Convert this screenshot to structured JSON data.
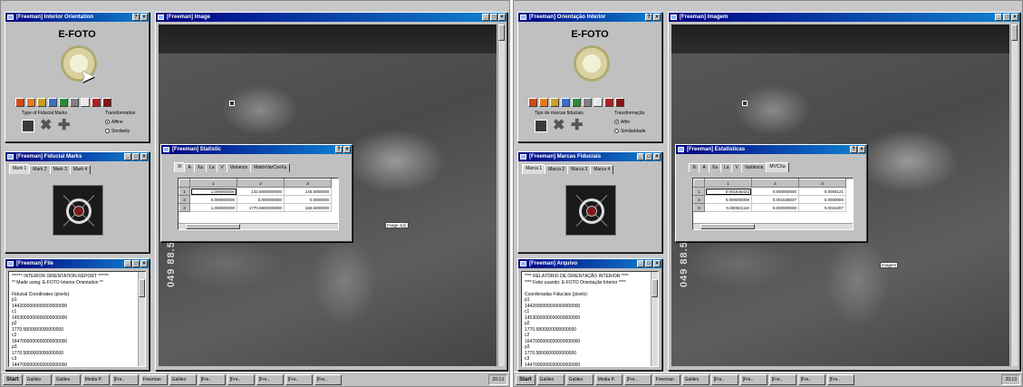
{
  "left": {
    "orientation_window": {
      "title": "[Freeman] Interior Orientation",
      "logo": "E-FOTO",
      "fiducial_group_label": "Type of Fiducial Marks",
      "transformation_group_label": "Transformation",
      "radio_affine": "Affine",
      "radio_similarity": "Similarity"
    },
    "fiducial_window": {
      "title": "[Freeman] Fiducial Marks",
      "tabs": [
        "Mark 1",
        "Mark 2",
        "Mark 3",
        "Mark 4"
      ]
    },
    "file_window": {
      "title": "[Freeman] File",
      "lines": [
        "****** INTERIOR ORIENTATION REPORT ******",
        "** Made using: E-FOTO Interior Orientation **",
        "",
        "Fiducial Coordinates (pixels):",
        "p1",
        "1442000000000000000000",
        "c1",
        "1453000000000000000000",
        "p2",
        "1770.5800000000000000",
        "c2",
        "1647000000000000000000",
        "p3",
        "1770.5800000000000000",
        "c3",
        "1447000000000000000000"
      ]
    },
    "image_window": {
      "title": "[Freeman] Image",
      "film_label": "049 88.57",
      "tag": "Image 1(s)"
    },
    "stats_window": {
      "title": "[Freeman] Statistic",
      "tabs": [
        "Xi",
        "A",
        "Xa",
        "La",
        "V",
        "Variance",
        "MatrixVarCovXa"
      ],
      "col_headers": [
        "",
        "1",
        "2",
        "3"
      ],
      "rows": [
        [
          "1",
          "1.000000000",
          "142.5000000000",
          "145.5000000"
        ],
        [
          "2",
          "0.000000000",
          "0.000000000",
          "0.0000000"
        ],
        [
          "3",
          "1.000000000",
          "1770.5800000000",
          "160.5000000"
        ]
      ]
    },
    "taskbar": {
      "start": "Start",
      "buttons": [
        "Galileo",
        "Galileo",
        "Media P.",
        "[Fre..",
        "Freeman",
        "Galileo",
        "[Fre..",
        "[Fre..",
        "[Fre..",
        "[Fre..",
        "[Fre.."
      ],
      "tray": "20:13"
    }
  },
  "right": {
    "orientation_window": {
      "title": "[Freeman] Orientação Interior",
      "logo": "E-FOTO",
      "fiducial_group_label": "Tipo de marcas fiduciais",
      "transformation_group_label": "Transformação",
      "radio_affine": "Afim",
      "radio_similarity": "Similaridade"
    },
    "fiducial_window": {
      "title": "[Freeman] Marcas Fiduciais",
      "tabs": [
        "Marca 1",
        "Marca 2",
        "Marca 3",
        "Marca 4"
      ]
    },
    "file_window": {
      "title": "[Freeman] Arquivo",
      "lines": [
        "**** RELATÓRIO DE ORIENTAÇÃO INTERIOR ****",
        "**** Feito usando: E-FOTO Orientação Interior ****",
        "",
        "Coordenadas Fiduciais (pixels):",
        "p1",
        "1442000000000000000000",
        "c1",
        "1453000000000000000000",
        "p2",
        "1770.5800000000000000",
        "c2",
        "1647000000000000000000",
        "p3",
        "1770.5800000000000000",
        "c3",
        "1447000000000000000000"
      ]
    },
    "image_window": {
      "title": "[Freeman] Imagem",
      "film_label": "049 88.57",
      "tag": "Imagem"
    },
    "stats_window": {
      "title": "[Freeman] Estatísticas",
      "tabs": [
        "Xi",
        "A",
        "Xa",
        "La",
        "V",
        "Variância",
        "MVCXa"
      ],
      "col_headers": [
        "",
        "1",
        "2",
        "3"
      ],
      "rows": [
        [
          "1",
          "0.001546421",
          "0.000000000",
          "0.0005121"
        ],
        [
          "2",
          "0.000000000",
          "0.001538037",
          "0.0000000"
        ],
        [
          "3",
          "0.000921110",
          "0.000000000",
          "0.0015307"
        ]
      ]
    },
    "taskbar": {
      "start": "Start",
      "buttons": [
        "Galileo",
        "Galileo",
        "Media P.",
        "[Fre..",
        "Freeman",
        "Galileo",
        "[Fre..",
        "[Fre..",
        "[Fre..",
        "[Fre..",
        "[Fre.."
      ],
      "tray": "20:13"
    }
  },
  "toolbar_icons": [
    {
      "name": "open-project-icon",
      "color": "#d24a1c"
    },
    {
      "name": "open-image-icon",
      "color": "#e07b22"
    },
    {
      "name": "save-icon",
      "color": "#c8a020"
    },
    {
      "name": "zoom-icon",
      "color": "#3a6fc8"
    },
    {
      "name": "calculate-icon",
      "color": "#2a8a3a"
    },
    {
      "name": "report-icon",
      "color": "#808080"
    },
    {
      "name": "blank-tool-icon",
      "color": "#e8e8e8"
    },
    {
      "name": "marker-icon",
      "color": "#b02020"
    },
    {
      "name": "exit-icon",
      "color": "#801818"
    }
  ]
}
